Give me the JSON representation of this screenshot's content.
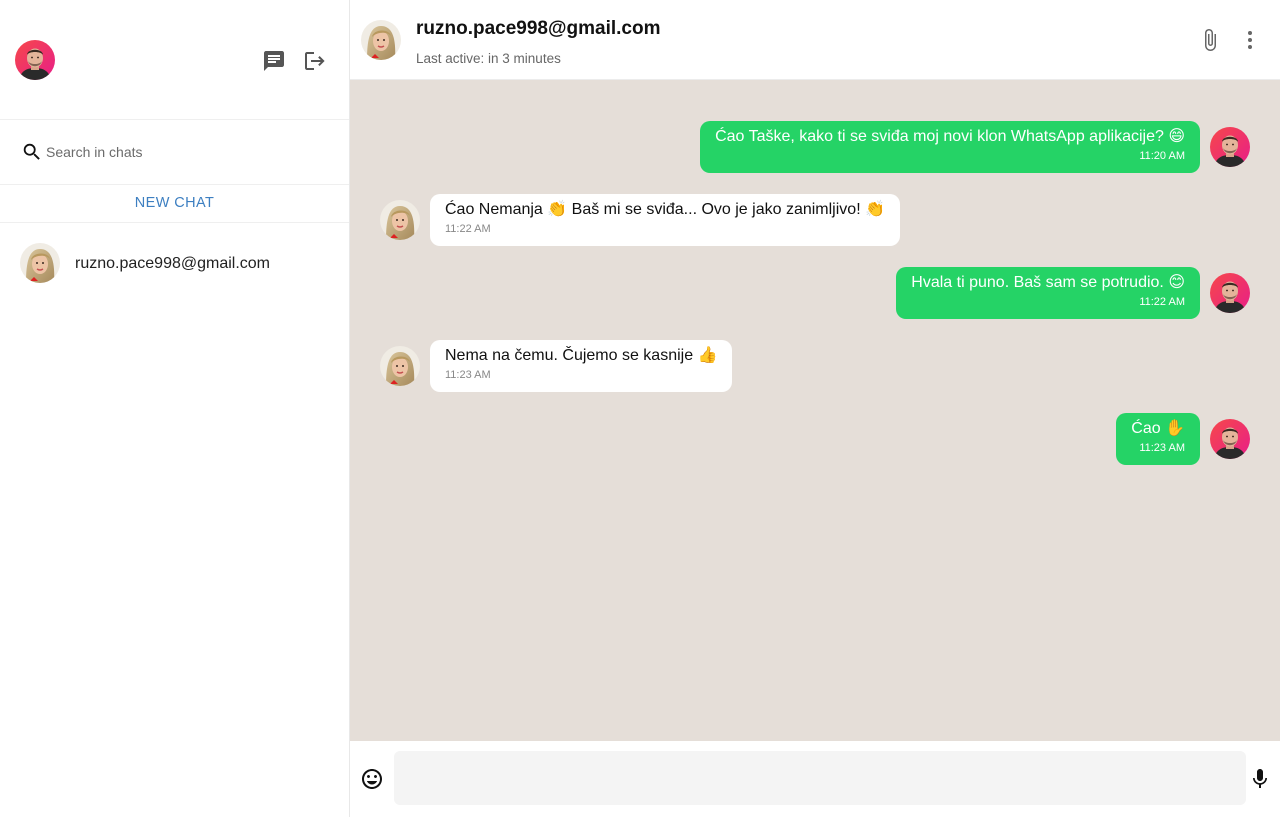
{
  "sidebar": {
    "user_avatar": "male-avatar",
    "icons": {
      "new_chat": "chat-icon",
      "logout": "logout-icon",
      "search": "search-icon"
    },
    "search": {
      "placeholder": "Search in chats",
      "value": ""
    },
    "new_chat_label": "NEW CHAT",
    "chats": [
      {
        "name": "ruzno.pace998@gmail.com",
        "avatar": "female-avatar"
      }
    ]
  },
  "chat_header": {
    "contact_name": "ruzno.pace998@gmail.com",
    "last_active": "Last active: in 3 minutes",
    "icons": {
      "attach": "paperclip-icon",
      "more": "more-vertical-icon"
    }
  },
  "messages": [
    {
      "direction": "sent",
      "text": "Ćao Taške, kako ti se sviđa moj novi klon WhatsApp aplikacije? 😄",
      "time": "11:20 AM"
    },
    {
      "direction": "received",
      "text": "Ćao Nemanja 👏 Baš mi se sviđa... Ovo je jako zanimljivo! 👏",
      "time": "11:22 AM"
    },
    {
      "direction": "sent",
      "text": "Hvala ti puno. Baš sam se potrudio. 😊",
      "time": "11:22 AM"
    },
    {
      "direction": "received",
      "text": "Nema na čemu. Čujemo se kasnije 👍",
      "time": "11:23 AM"
    },
    {
      "direction": "sent",
      "text": "Ćao ✋",
      "time": "11:23 AM"
    }
  ],
  "composer": {
    "placeholder": "",
    "value": "",
    "icons": {
      "emoji": "emoji-icon",
      "mic": "microphone-icon"
    }
  },
  "colors": {
    "sent_bubble": "#25d366",
    "received_bubble": "#ffffff",
    "chat_background": "#e5ded8",
    "accent_link": "#3d7fc1",
    "user_avatar_bg": "#ec3a5e"
  }
}
